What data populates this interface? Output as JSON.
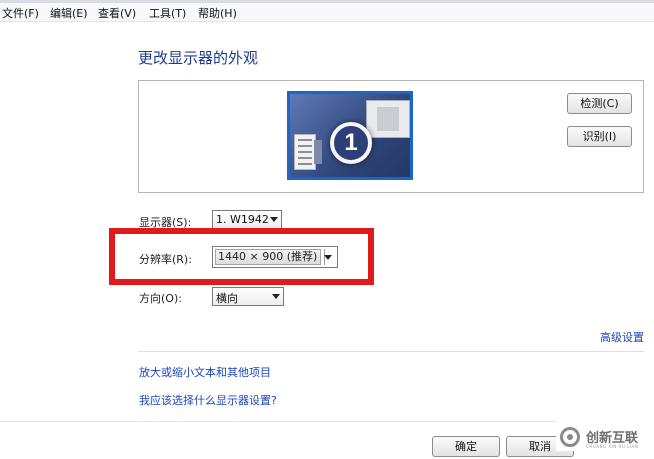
{
  "menubar": {
    "items": [
      "文件(F)",
      "编辑(E)",
      "查看(V)",
      "工具(T)",
      "帮助(H)"
    ]
  },
  "page": {
    "title": "更改显示器的外观"
  },
  "preview": {
    "monitor_number": "1",
    "detect_button": "检测(C)",
    "identify_button": "识别(I)"
  },
  "settings": {
    "display_label": "显示器(S):",
    "display_value": "1. W1942",
    "resolution_label": "分辨率(R):",
    "resolution_value": "1440 × 900 (推荐)",
    "orientation_label": "方向(O):",
    "orientation_value": "横向"
  },
  "links": {
    "advanced": "高级设置",
    "text_size": "放大或缩小文本和其他项目",
    "help": "我应该选择什么显示器设置?"
  },
  "footer": {
    "ok_button": "确定",
    "cancel_button": "取消"
  },
  "watermark": {
    "text": "创新互联",
    "subtext": "CHUANG XIN HU LIAN"
  },
  "colors": {
    "highlight": "#e01b1b",
    "link": "#1a47b8",
    "heading": "#1e3c8c",
    "monitor_border": "#1a67c8"
  },
  "icons": {
    "monitor": "monitor-preview-icon",
    "dropdown": "chevron-down-icon",
    "watermark_logo": "chuangxin-logo-icon"
  }
}
